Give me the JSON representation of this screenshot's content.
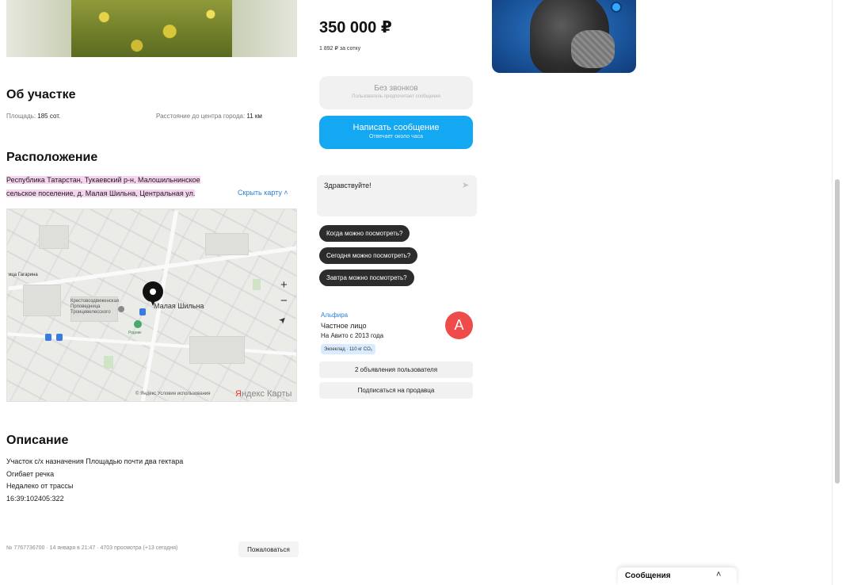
{
  "about": {
    "title": "Об участке",
    "area_label": "Площадь: ",
    "area_value": "185 сот.",
    "distance_label": "Расстояние до центра города: ",
    "distance_value": "11 км"
  },
  "location": {
    "title": "Расположение",
    "address_line1": "Республика Татарстан, Тукаевский р-н, Малошильнинское",
    "address_line2": "сельское поселение, д. Малая Шильна, Центральная ул.",
    "hide_map": "Скрыть карту ˄"
  },
  "map": {
    "street_label": "ица Гагарина",
    "place_label": "Малая Шильна",
    "church_label_1": "Крестовоздвиженская",
    "church_label_2": "Прповедница",
    "church_label_3": "Троицевелесского",
    "poi_label": "Родник",
    "zoom_in": "+",
    "zoom_out": "−",
    "locate": "➤",
    "copyright": "© Яндекс Условия использования",
    "brand_a": "Я",
    "brand_b": "ндекс Карты"
  },
  "description": {
    "title": "Описание",
    "lines": [
      "Участок с/х назначения Площадью почти два гектара",
      "Огибает речка",
      "Недалеко от трассы",
      "16:39:102405:322"
    ]
  },
  "listing_meta": {
    "text": "№ 7767736700 · 14 января в 21:47 · 4703 просмотра (+13 сегодня)",
    "complain": "Пожаловаться"
  },
  "pricing": {
    "price": "350 000 ₽",
    "per_unit": "1 892 ₽ за сотку"
  },
  "contact": {
    "no_calls_title": "Без звонков",
    "no_calls_sub": "Пользователь предпочитает сообщения",
    "message_title": "Написать сообщение",
    "message_sub": "Отвечает около часа"
  },
  "chat": {
    "greeting": "Здравствуйте!",
    "quick_replies": [
      "Когда можно посмотреть?",
      "Сегодня можно посмотреть?",
      "Завтра можно посмотреть?"
    ]
  },
  "seller": {
    "name": "Альфира",
    "type": "Частное лицо",
    "since": "На Авито с 2013 года",
    "eco": "Экоеклад · 110 кг CO₂",
    "avatar_letter": "A",
    "avatar_color": "#ef4b4b",
    "listings_button": "2 объявления пользователя",
    "subscribe_button": "Подписаться на продавца"
  },
  "messages_bar": {
    "label": "Сообщения",
    "chevron": "˄"
  },
  "colors": {
    "accent": "#14a8f3",
    "link": "#2a7fd6",
    "highlight": "#f6d3ee"
  }
}
